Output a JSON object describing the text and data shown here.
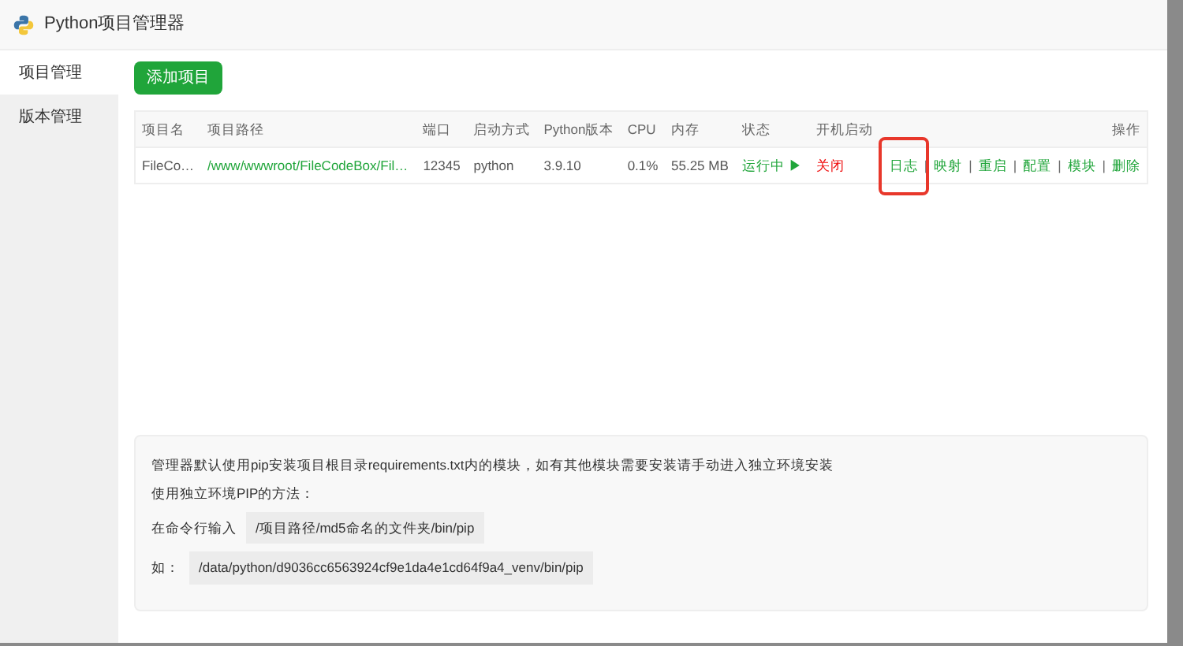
{
  "window": {
    "title": "Python项目管理器"
  },
  "sidebar": {
    "items": [
      {
        "label": "项目管理",
        "selected": true
      },
      {
        "label": "版本管理",
        "selected": false
      }
    ]
  },
  "add_button": "添加项目",
  "table": {
    "columns": [
      "项目名",
      "项目路径",
      "端口",
      "启动方式",
      "Python版本",
      "CPU",
      "内存",
      "状态",
      "开机启动",
      "操作"
    ],
    "rows": [
      {
        "name": "FileCo…",
        "path": "/www/wwwroot/FileCodeBox/Fil…",
        "port": "12345",
        "start_mode": "python",
        "version": "3.9.10",
        "cpu": "0.1%",
        "memory": "55.25 MB",
        "status": "运行中",
        "status_icon": "▶",
        "running": true,
        "autostart": "关闭",
        "autostart_on": false,
        "actions": [
          {
            "label": "日志",
            "highlighted": true
          },
          {
            "label": "映射",
            "highlighted": false
          },
          {
            "label": "重启",
            "highlighted": false
          },
          {
            "label": "配置",
            "highlighted": false
          },
          {
            "label": "模块",
            "highlighted": false
          },
          {
            "label": "删除",
            "highlighted": false
          }
        ],
        "separator": "|"
      }
    ]
  },
  "info": {
    "line1": "管理器默认使用pip安装项目根目录requirements.txt内的模块，如有其他模块需要安装请手动进入独立环境安装",
    "line2": "使用独立环境PIP的方法：",
    "line3_label": "在命令行输入",
    "line3_code": "/项目路径/md5命名的文件夹/bin/pip",
    "line4_label": "如：",
    "line4_code": "/data/python/d9036cc6563924cf9e1da4e1cd64f9a4_venv/bin/pip"
  }
}
